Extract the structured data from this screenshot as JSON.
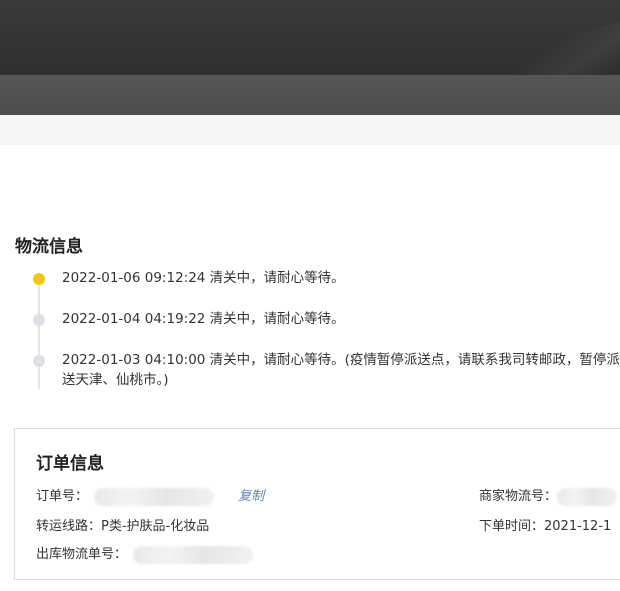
{
  "logistics": {
    "title": "物流信息",
    "events": [
      {
        "text": "2022-01-06 09:12:24 清关中，请耐心等待。",
        "status": "current"
      },
      {
        "text": "2022-01-04 04:19:22 清关中，请耐心等待。",
        "status": "past"
      },
      {
        "text": "2022-01-03 04:10:00 清关中，请耐心等待。(疫情暂停派送点，请联系我司转邮政，暂停派送天津、仙桃市。)",
        "status": "past"
      }
    ]
  },
  "order": {
    "title": "订单信息",
    "order_no_label": "订单号：",
    "copy_label": "复制",
    "merchant_tracking_label": "商家物流号：",
    "route_label": "转运线路：",
    "route_value": "P类-护肤品-化妆品",
    "order_time_label": "下单时间：",
    "order_time_value": "2021-12-1",
    "outbound_no_label": "出库物流单号："
  },
  "colors": {
    "active_dot": "#f5c518",
    "inactive_dot": "#dcdfe6",
    "copy_link": "#5b7fb8"
  }
}
